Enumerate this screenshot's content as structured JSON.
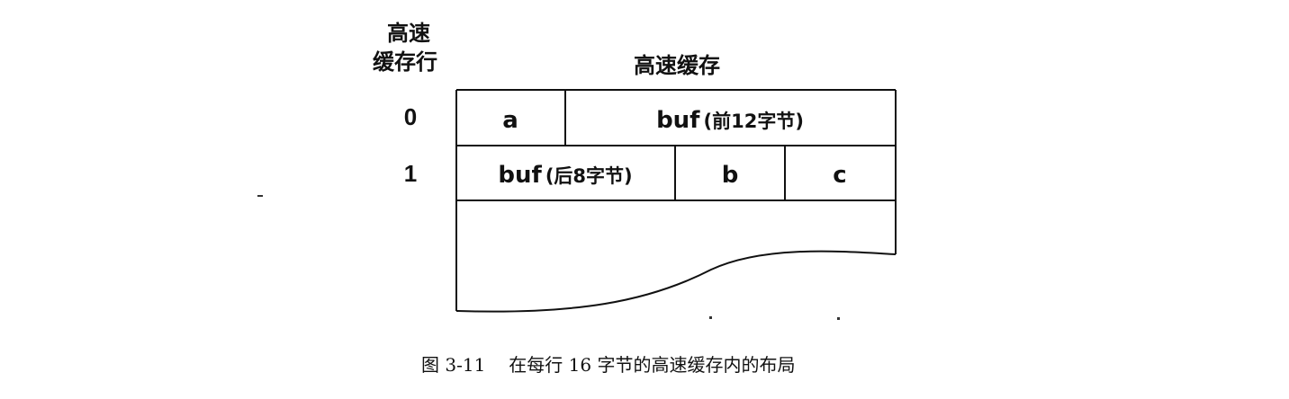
{
  "header": {
    "row_header_line1": "高速",
    "row_header_line2": "缓存行",
    "cache_title": "高速缓存"
  },
  "rows": [
    {
      "label": "0",
      "cells": [
        {
          "text_main": "a",
          "text_note": ""
        },
        {
          "text_main": "buf",
          "text_note": "(前12字节)"
        }
      ]
    },
    {
      "label": "1",
      "cells": [
        {
          "text_main": "buf",
          "text_note": "(后8字节)"
        },
        {
          "text_main": "b",
          "text_note": ""
        },
        {
          "text_main": "c",
          "text_note": ""
        }
      ]
    }
  ],
  "caption": {
    "figure_number": "图 3-11",
    "text": "在每行 16 字节的高速缓存内的布局"
  }
}
